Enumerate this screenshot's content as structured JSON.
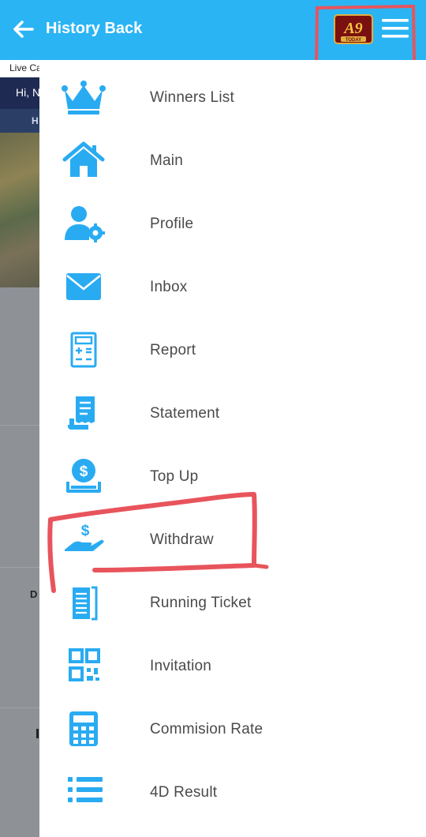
{
  "header": {
    "title": "History Back",
    "logo_text": "A9",
    "logo_subtext": "TODAY"
  },
  "background_page": {
    "live_text": "Live Ca",
    "greeting": "Hi, N",
    "tab_letter": "H",
    "row_letter": "D"
  },
  "menu": {
    "items": [
      {
        "label": "Winners List",
        "icon": "crown-icon"
      },
      {
        "label": "Main",
        "icon": "home-icon"
      },
      {
        "label": "Profile",
        "icon": "user-gear-icon"
      },
      {
        "label": "Inbox",
        "icon": "envelope-icon"
      },
      {
        "label": "Report",
        "icon": "calculator-report-icon"
      },
      {
        "label": "Statement",
        "icon": "receipt-scroll-icon"
      },
      {
        "label": "Top Up",
        "icon": "coin-deposit-icon"
      },
      {
        "label": "Withdraw",
        "icon": "hand-dollar-icon"
      },
      {
        "label": "Running Ticket",
        "icon": "ticket-document-icon"
      },
      {
        "label": "Invitation",
        "icon": "qr-code-icon"
      },
      {
        "label": "Commision Rate",
        "icon": "calculator-icon"
      },
      {
        "label": "4D Result",
        "icon": "list-icon"
      }
    ]
  },
  "colors": {
    "header_bg": "#2ab4f4",
    "icon_blue": "#29abf2",
    "annotation_red": "#e8545c",
    "label_text": "#4a4a4a"
  }
}
